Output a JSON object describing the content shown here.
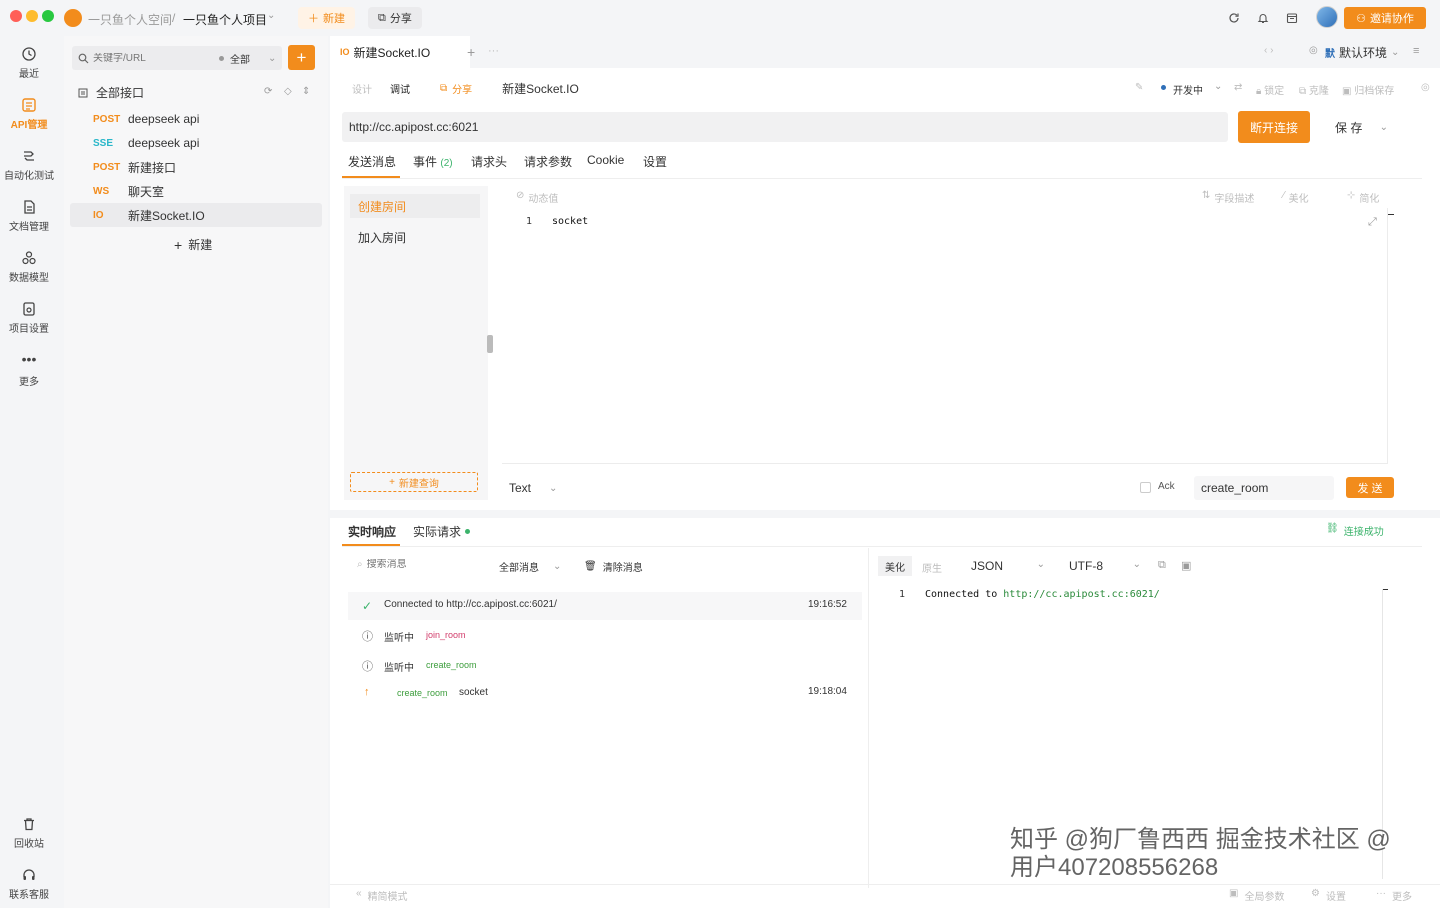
{
  "colors": {
    "accent": "#f28c1c",
    "success": "#3bb36b",
    "sse": "#2ab7c9",
    "pink": "#d23c6b"
  },
  "titlebar": {
    "workspace": "一只鱼个人空间",
    "separator": "/",
    "project": "一只鱼个人项目",
    "new_label": "新建",
    "share_label": "分享",
    "invite_label": "邀请协作"
  },
  "rail": {
    "recent": "最近",
    "api": "API管理",
    "auto_test": "自动化测试",
    "docs": "文档管理",
    "data_model": "数据模型",
    "project_settings": "项目设置",
    "more": "更多",
    "trash": "回收站",
    "support": "联系客服"
  },
  "sidebar": {
    "search_placeholder": "关键字/URL",
    "filter_label": "全部",
    "root_label": "全部接口",
    "items": [
      {
        "method": "POST",
        "name": "deepseek api"
      },
      {
        "method": "SSE",
        "name": "deepseek api"
      },
      {
        "method": "POST",
        "name": "新建接口"
      },
      {
        "method": "WS",
        "name": "聊天室"
      },
      {
        "method": "IO",
        "name": "新建Socket.IO"
      }
    ],
    "new_label": "新建"
  },
  "tabbar": {
    "tab_badge": "IO",
    "tab_title": "新建Socket.IO",
    "env_badge": "默",
    "env_label": "默认环境"
  },
  "toolbar": {
    "design": "设计",
    "debug": "调试",
    "share": "分享",
    "name": "新建Socket.IO",
    "status": "开发中",
    "lock": "锁定",
    "clone": "克隆",
    "archive": "归档保存"
  },
  "request": {
    "url": "http://cc.apipost.cc:6021",
    "disconnect_label": "断开连接",
    "save_label": "保 存",
    "tabs": [
      "发送消息",
      "事件",
      "请求头",
      "请求参数",
      "Cookie",
      "设置"
    ],
    "events_count": "(2)"
  },
  "messages": {
    "list": [
      "创建房间",
      "加入房间"
    ],
    "new_query": "新建查询",
    "editor_toolbar": {
      "dynamic": "动态值",
      "field_desc": "字段描述",
      "beautify": "美化",
      "simplify": "简化"
    },
    "editor_line": "1",
    "editor_text": "socket",
    "format": "Text",
    "ack_label": "Ack",
    "event_name": "create_room",
    "send_label": "发 送"
  },
  "response": {
    "tabs": [
      "实时响应",
      "实际请求"
    ],
    "connection_status": "连接成功",
    "search_placeholder": "搜索消息",
    "filter_label": "全部消息",
    "clear_label": "清除消息",
    "rows": [
      {
        "icon": "check-circle",
        "text": "Connected to http://cc.apipost.cc:6021/",
        "tag": "",
        "time": "19:16:52"
      },
      {
        "icon": "info-circle",
        "text": "监听中",
        "tag": "join_room",
        "time": ""
      },
      {
        "icon": "info-circle",
        "text": "监听中",
        "tag": "create_room",
        "time": ""
      },
      {
        "icon": "arrow-up",
        "text": "socket",
        "tag": "create_room",
        "time": "19:18:04"
      }
    ],
    "viewer": {
      "beautify": "美化",
      "raw": "原生",
      "format": "JSON",
      "encoding": "UTF-8",
      "line_no": "1",
      "line_prefix": "Connected to ",
      "line_url": "http://cc.apipost.cc:6021/"
    }
  },
  "statusbar": {
    "simple_mode": "精简模式",
    "global_params": "全局参数",
    "settings": "设置",
    "more": "更多"
  },
  "watermark": "知乎 @狗厂鲁西西 掘金技术社区 @ 用户4072085562​68"
}
